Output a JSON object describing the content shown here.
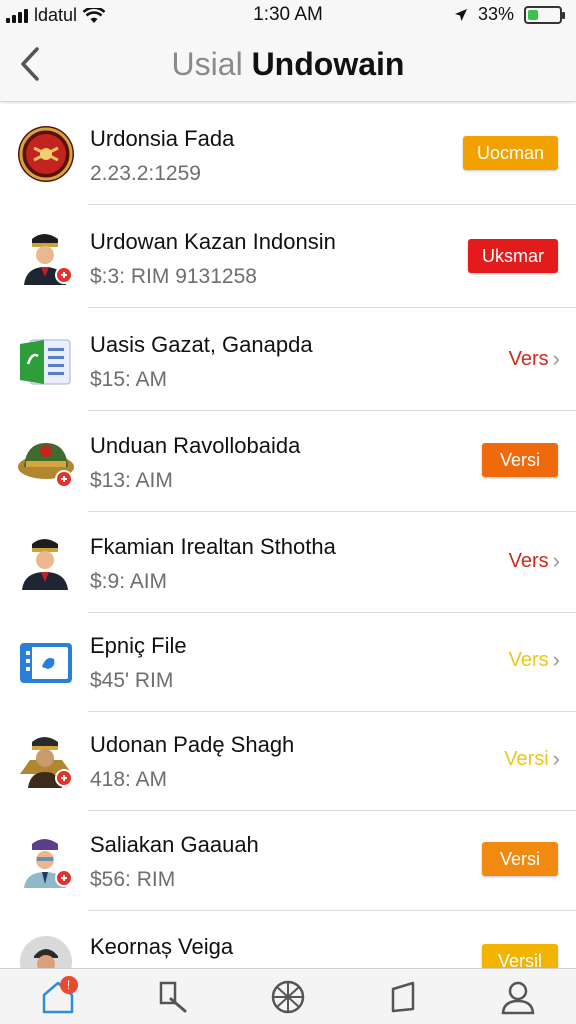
{
  "status_bar": {
    "carrier": "ldatul",
    "time": "1:30 AM",
    "battery_percent": "33%",
    "battery_level": 0.33
  },
  "header": {
    "title_light": "Usial",
    "title_bold": "Undowain"
  },
  "rows": [
    {
      "name": "Urdonsia Fada",
      "sub": "2.23.2:1259",
      "action": "Uocman",
      "action_style": "button",
      "color": "#f2a100",
      "avatar": "red-emblem-icon"
    },
    {
      "name": "Urdowan Kazan Indonsin",
      "sub": "$:3: RIM  9131258",
      "action": "Uksmar",
      "action_style": "button",
      "color": "#e41b1b",
      "avatar": "officer-avatar-icon"
    },
    {
      "name": "Uasis Gazat, Ganapda",
      "sub": "$15: AM",
      "action": "Vers",
      "action_style": "link",
      "color": "#d02a1a",
      "avatar": "document-icon"
    },
    {
      "name": "Unduan Ravollobaida",
      "sub": "$13: AIM",
      "action": "Versi",
      "action_style": "button",
      "color": "#ef6a0c",
      "avatar": "military-cap-icon"
    },
    {
      "name": "Fkamian Irealtan Sthotha",
      "sub": "$:9: AIM",
      "action": "Vers",
      "action_style": "link",
      "color": "#d02a1a",
      "avatar": "officer-avatar-icon"
    },
    {
      "name": "Epniç File",
      "sub": "$45' RIM",
      "action": "Vers",
      "action_style": "link",
      "color": "#f0c419",
      "avatar": "file-app-icon"
    },
    {
      "name": "Udonan Padę Shagh",
      "sub": "418: AM",
      "action": "Versi",
      "action_style": "link",
      "color": "#f0c419",
      "avatar": "general-avatar-icon"
    },
    {
      "name": "Saliakan Gaauah",
      "sub": "$56: RIM",
      "action": "Versi",
      "action_style": "button",
      "color": "#f08a10",
      "avatar": "soldier-avatar-icon"
    },
    {
      "name": "Keornaș Veiga",
      "sub": "",
      "action": "Versil",
      "action_style": "button",
      "color": "#f2b400",
      "avatar": "person-avatar-icon"
    }
  ],
  "tab_bar": {
    "items": [
      "home-icon",
      "search-icon",
      "globe-icon",
      "bookmark-icon",
      "profile-icon"
    ],
    "home_badge": "!"
  },
  "colors": {
    "accent_blue": "#2a8fd8",
    "battery_green": "#3ac24a"
  }
}
